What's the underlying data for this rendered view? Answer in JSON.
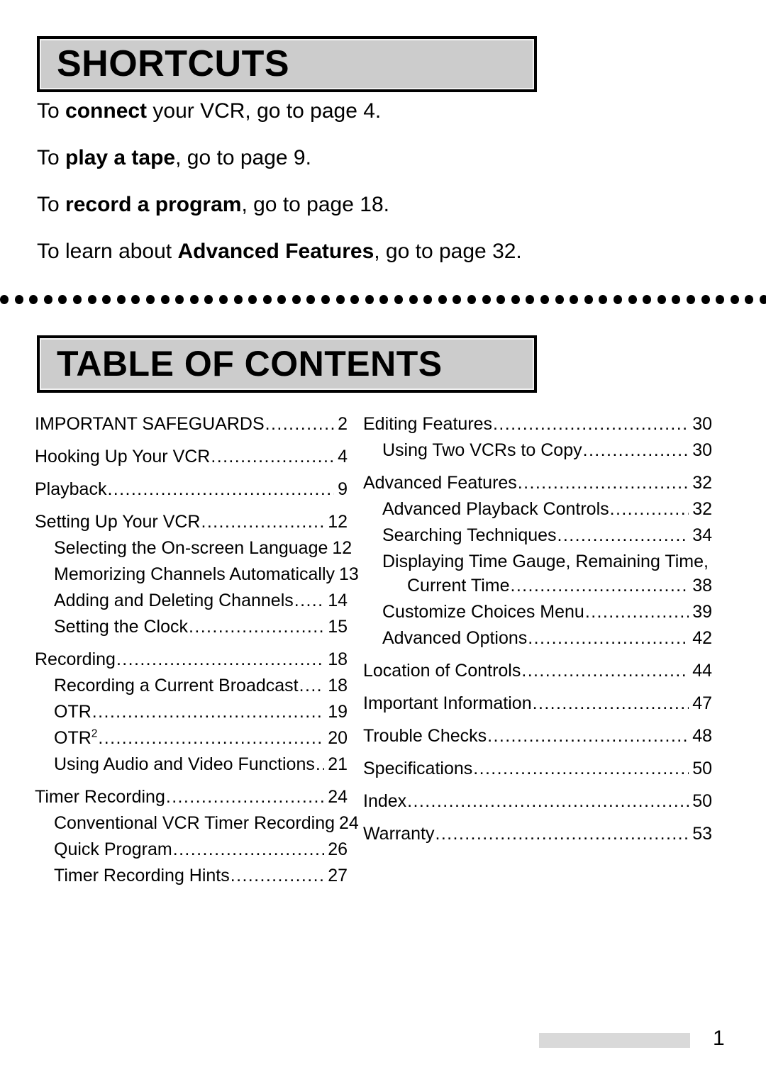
{
  "shortcuts": {
    "heading": "SHORTCUTS",
    "lines": [
      {
        "pre": "To ",
        "bold": "connect",
        "post": " your VCR, go to page 4."
      },
      {
        "pre": "To ",
        "bold": "play a tape",
        "post": ", go to page 9."
      },
      {
        "pre": "To ",
        "bold": "record a program",
        "post": ", go to page 18."
      },
      {
        "pre": "To learn about ",
        "bold": "Advanced Features",
        "post": ", go to page 32."
      }
    ]
  },
  "divider": {
    "dot_count": 53
  },
  "toc": {
    "heading": "TABLE OF CONTENTS",
    "left_column": [
      {
        "level": 0,
        "title": "IMPORTANT SAFEGUARDS",
        "page": "2"
      },
      {
        "level": 0,
        "title": "Hooking Up Your VCR ",
        "page": "4"
      },
      {
        "level": 0,
        "title": "Playback",
        "page": "9"
      },
      {
        "level": 0,
        "title": "Setting Up Your VCR ",
        "page": "12"
      },
      {
        "level": 1,
        "title": "Selecting the On-screen Language ",
        "page": "12"
      },
      {
        "level": 1,
        "title": "Memorizing Channels Automatically ",
        "page": "13"
      },
      {
        "level": 1,
        "title": "Adding and Deleting Channels ",
        "page": "14"
      },
      {
        "level": 1,
        "title": "Setting the Clock ",
        "page": "15"
      },
      {
        "level": 0,
        "title": "Recording ",
        "page": "18"
      },
      {
        "level": 1,
        "title": "Recording a Current Broadcast ",
        "page": "18"
      },
      {
        "level": 1,
        "title": "OTR ",
        "page": "19"
      },
      {
        "level": 1,
        "title": "OTR",
        "sup": "2",
        "page": "20"
      },
      {
        "level": 1,
        "title": "Using Audio and Video Functions",
        "page": "21"
      },
      {
        "level": 0,
        "title": "Timer Recording ",
        "page": "24"
      },
      {
        "level": 1,
        "title": "Conventional VCR Timer Recording",
        "page": "24"
      },
      {
        "level": 1,
        "title": "Quick Program",
        "page": "26"
      },
      {
        "level": 1,
        "title": "Timer Recording Hints ",
        "page": "27"
      }
    ],
    "right_column": [
      {
        "level": 0,
        "title": "Editing Features ",
        "page": "30"
      },
      {
        "level": 1,
        "title": "Using Two VCRs to Copy ",
        "page": "30"
      },
      {
        "level": 0,
        "title": "Advanced Features ",
        "page": "32"
      },
      {
        "level": 1,
        "title": "Advanced Playback Controls",
        "page": "32"
      },
      {
        "level": 1,
        "title": "Searching Techniques ",
        "page": "34"
      },
      {
        "level": 1,
        "wrapline": "Displaying Time Gauge, Remaining Time,"
      },
      {
        "level": 2,
        "title": "Current Time ",
        "page": "38"
      },
      {
        "level": 1,
        "title": "Customize Choices Menu",
        "page": "39"
      },
      {
        "level": 1,
        "title": "Advanced Options ",
        "page": "42"
      },
      {
        "level": 0,
        "title": "Location of Controls ",
        "page": "44"
      },
      {
        "level": 0,
        "title": "Important Information ",
        "page": "47"
      },
      {
        "level": 0,
        "title": "Trouble Checks ",
        "page": "48"
      },
      {
        "level": 0,
        "title": "Specifications ",
        "page": "50"
      },
      {
        "level": 0,
        "title": "Index ",
        "page": "50"
      },
      {
        "level": 0,
        "title": "Warranty",
        "page": "53"
      }
    ]
  },
  "footer": {
    "page_number": "1"
  }
}
